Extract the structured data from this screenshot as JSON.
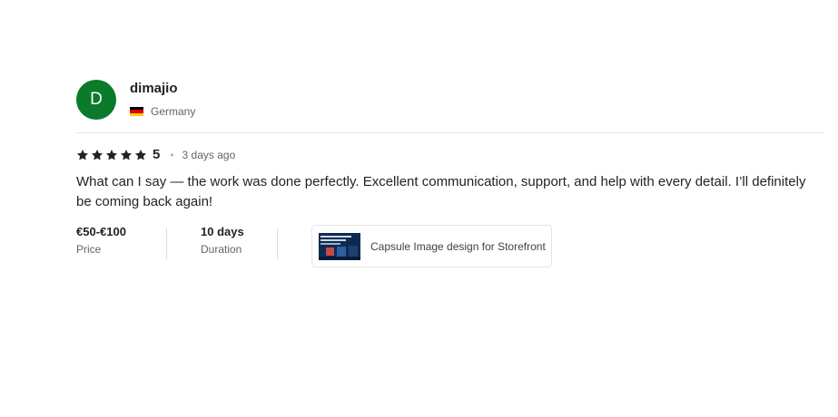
{
  "reviewer": {
    "avatar_initial": "D",
    "username": "dimajio",
    "country": "Germany",
    "flag_colors": [
      "#000000",
      "#dd0000",
      "#ffce00"
    ],
    "avatar_color": "#0a7a2b"
  },
  "rating": {
    "stars": 5,
    "value": "5",
    "separator": "•",
    "date": "3 days ago"
  },
  "review_text": "What can I say — the work was done perfectly. Excellent communication, support, and help with every detail. I’ll definitely be coming back again!",
  "details": {
    "price_value": "€50-€100",
    "price_label": "Price",
    "duration_value": "10 days",
    "duration_label": "Duration"
  },
  "gig": {
    "title": "Capsule Image design for Storefront",
    "thumbnail_icon": "capsule-image-thumbnail"
  }
}
